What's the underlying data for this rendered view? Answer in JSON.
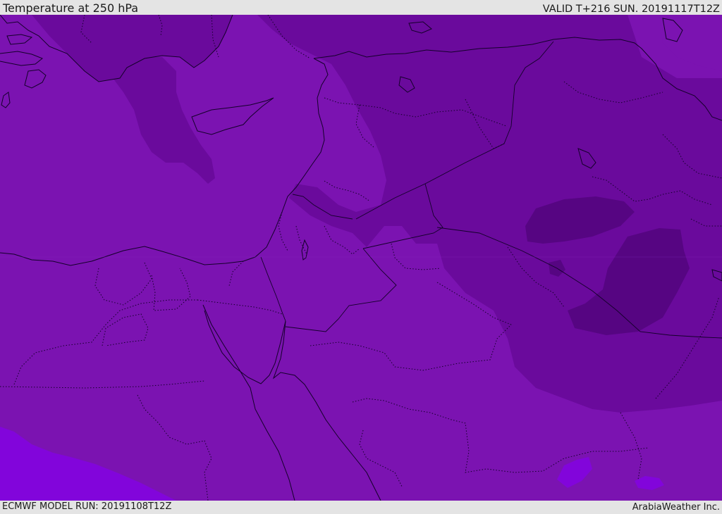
{
  "header": {
    "title": "Temperature at 250 hPa",
    "valid_time": "VALID T+216 SUN. 20191117T12Z"
  },
  "footer": {
    "model_run": "ECMWF MODEL RUN: 20191108T12Z",
    "credit": "ArabiaWeather Inc."
  },
  "colors": {
    "base_shade": "#7b13b1",
    "mid_shade": "#6a0a9c",
    "dark_shade": "#560582",
    "warm_shade": "#8205db",
    "outline": "#14002a"
  }
}
